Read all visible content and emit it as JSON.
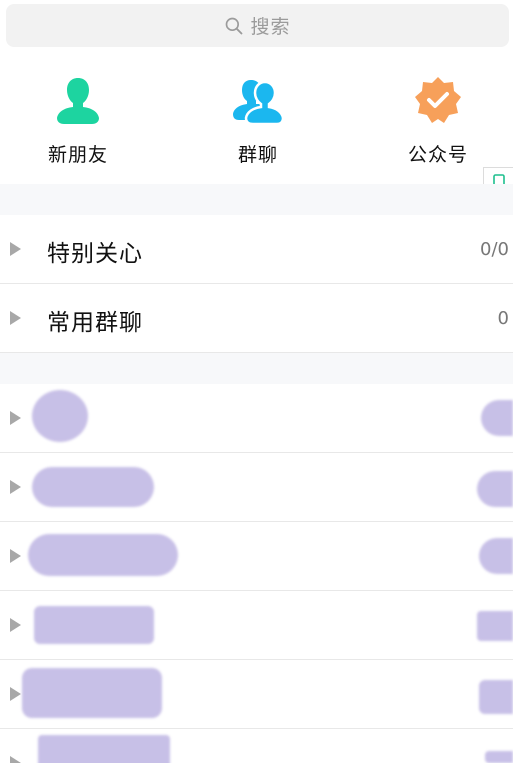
{
  "search": {
    "placeholder": "搜索",
    "icon": "search-icon"
  },
  "quick_actions": [
    {
      "label": "新朋友",
      "icon": "new-friend-icon",
      "color": "#1dd4a0"
    },
    {
      "label": "群聊",
      "icon": "group-chat-icon",
      "color": "#1bb7ef"
    },
    {
      "label": "公众号",
      "icon": "official-account-icon",
      "color": "#f7a05a"
    }
  ],
  "groups": [
    {
      "name": "特别关心",
      "count": "0/0"
    },
    {
      "name": "常用群聊",
      "count": "0"
    }
  ],
  "colors": {
    "background": "#ffffff",
    "section_gap": "#f7f8fa",
    "search_bg": "#f2f2f2",
    "arrow": "#a8a8a8",
    "blur_blob": "#c5bde6"
  }
}
